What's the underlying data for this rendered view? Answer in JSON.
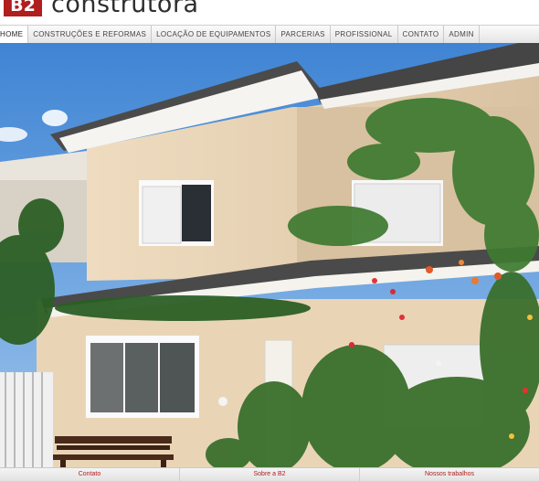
{
  "logo": {
    "badge": "B2",
    "word": "construtora"
  },
  "nav": {
    "items": [
      {
        "label": "HOME",
        "active": true
      },
      {
        "label": "CONSTRUÇÕES E REFORMAS"
      },
      {
        "label": "LOCAÇÃO DE EQUIPAMENTOS"
      },
      {
        "label": "PARCERIAS"
      },
      {
        "label": "PROFISSIONAL"
      },
      {
        "label": "CONTATO"
      },
      {
        "label": "ADMIN"
      }
    ]
  },
  "footer": {
    "links": [
      "Contato",
      "Sobre a B2",
      "Nossos trabalhos"
    ]
  },
  "colors": {
    "brand": "#b01e1e",
    "sky": "#4f8fd6",
    "wall": "#e6d2b5",
    "roof": "#4a4a4a",
    "ivy": "#2f6b2a"
  }
}
